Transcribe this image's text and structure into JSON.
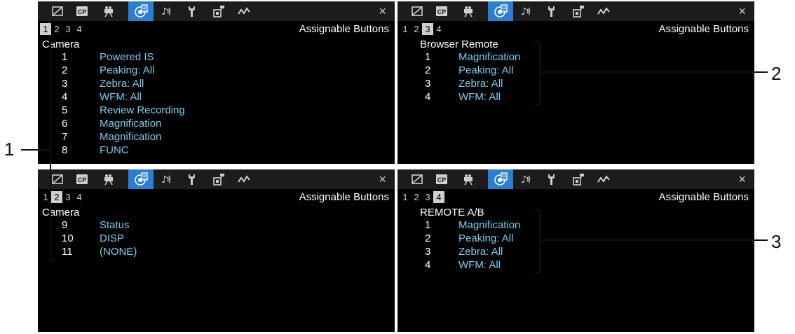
{
  "screens": [
    {
      "pages": [
        "1",
        "2",
        "3",
        "4"
      ],
      "selected_page": 0,
      "title": "Assignable Buttons",
      "group": "Camera",
      "rows": [
        {
          "n": "1",
          "v": "Powered IS"
        },
        {
          "n": "2",
          "v": "Peaking: All"
        },
        {
          "n": "3",
          "v": "Zebra: All"
        },
        {
          "n": "4",
          "v": "WFM: All"
        },
        {
          "n": "5",
          "v": "Review Recording"
        },
        {
          "n": "6",
          "v": "Magnification"
        },
        {
          "n": "7",
          "v": "Magnification"
        },
        {
          "n": "8",
          "v": "FUNC"
        }
      ]
    },
    {
      "pages": [
        "1",
        "2",
        "3",
        "4"
      ],
      "selected_page": 2,
      "title": "Assignable Buttons",
      "group": "Browser Remote",
      "rows": [
        {
          "n": "1",
          "v": "Magnification"
        },
        {
          "n": "2",
          "v": "Peaking: All"
        },
        {
          "n": "3",
          "v": "Zebra: All"
        },
        {
          "n": "4",
          "v": "WFM: All"
        }
      ]
    },
    {
      "pages": [
        "1",
        "2",
        "3",
        "4"
      ],
      "selected_page": 1,
      "title": "Assignable Buttons",
      "group": "Camera",
      "rows": [
        {
          "n": "9",
          "v": "Status"
        },
        {
          "n": "10",
          "v": "DISP"
        },
        {
          "n": "11",
          "v": "(NONE)"
        }
      ]
    },
    {
      "pages": [
        "1",
        "2",
        "3",
        "4"
      ],
      "selected_page": 3,
      "title": "Assignable Buttons",
      "group": "REMOTE A/B",
      "rows": [
        {
          "n": "1",
          "v": "Magnification"
        },
        {
          "n": "2",
          "v": "Peaking: All"
        },
        {
          "n": "3",
          "v": "Zebra: All"
        },
        {
          "n": "4",
          "v": "WFM: All"
        }
      ]
    }
  ],
  "tab_icons": [
    "monitor-icon",
    "cp-icon",
    "camera-icon",
    "assignable-buttons-icon",
    "audio-icon",
    "wrench-icon",
    "my-menu-icon",
    "waveform-icon"
  ],
  "selected_tab": 3,
  "close_glyph": "×",
  "callouts": [
    "1",
    "2",
    "3"
  ],
  "colors": {
    "value_text": "#74cff0",
    "selected_tab": "#2a7fd4",
    "screen_bg": "#000000",
    "tabbar_bg": "#1c1c1c"
  }
}
